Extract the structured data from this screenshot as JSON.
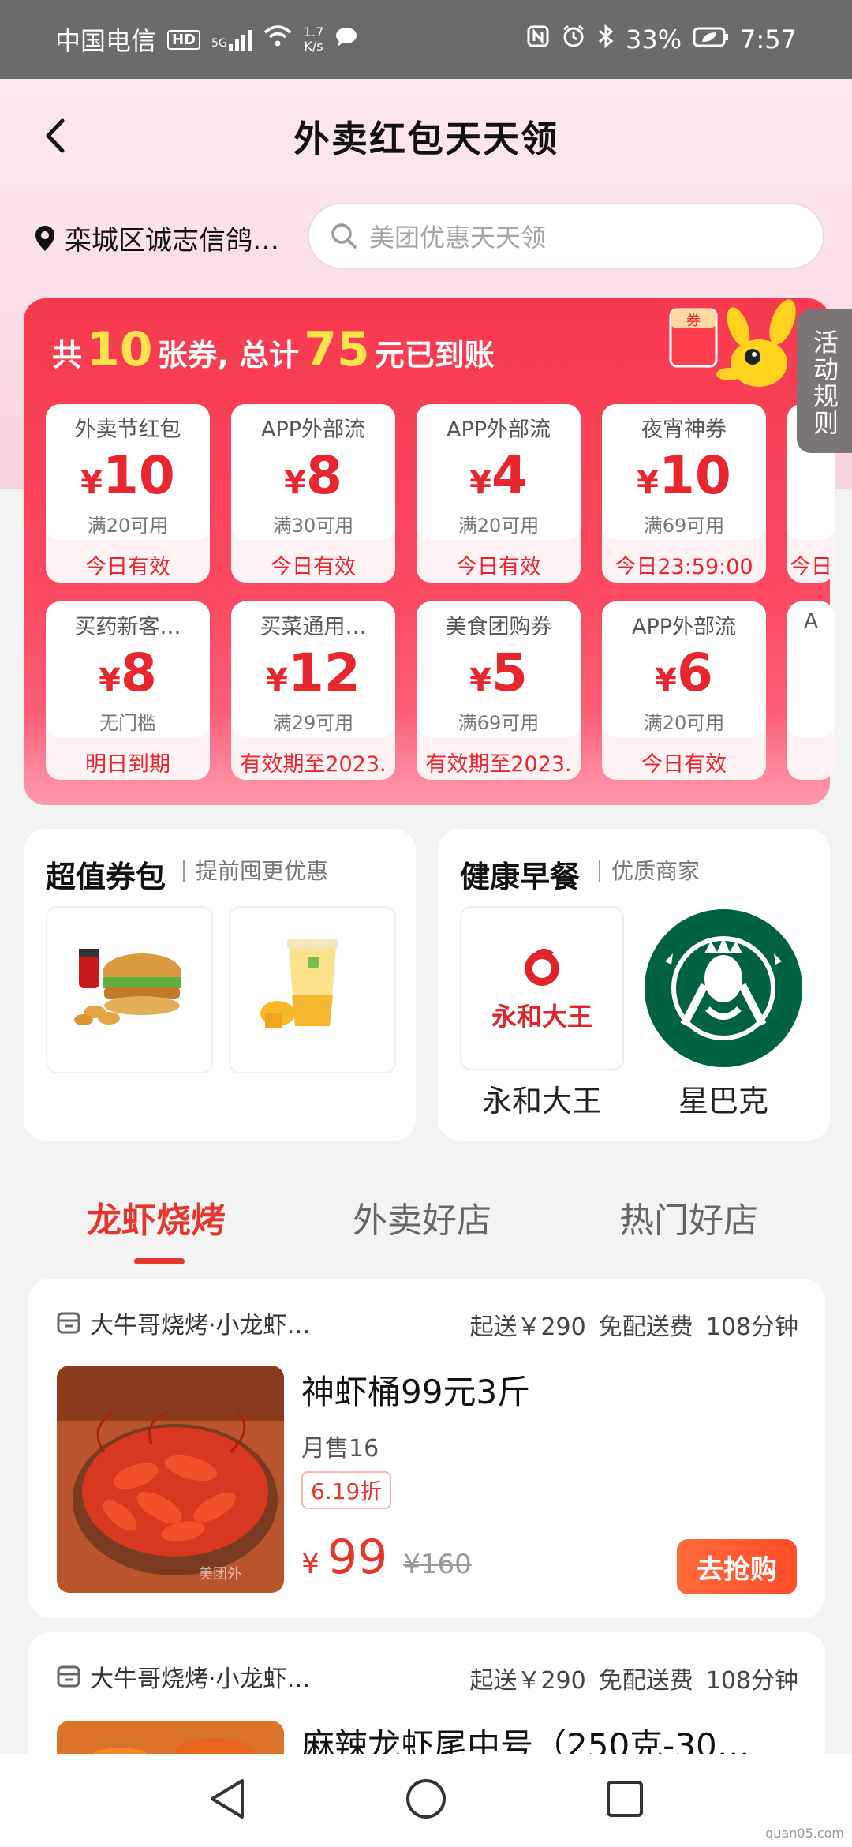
{
  "status_bar": {
    "carrier": "中国电信",
    "hd": "HD",
    "network": "5G",
    "speed_value": "1.7",
    "speed_unit": "K/s",
    "battery": "33%",
    "time": "7:57"
  },
  "header": {
    "title": "外卖红包天天领"
  },
  "location": {
    "text": "栾城区诚志信鸽…"
  },
  "search": {
    "placeholder": "美团优惠天天领"
  },
  "rules_tab": "活动规则",
  "summary": {
    "prefix": "共",
    "count": "10",
    "mid": "张券, 总计",
    "amount": "75",
    "suffix": "元已到账"
  },
  "coupons": [
    {
      "name": "外卖节红包",
      "symbol": "¥",
      "amount": "10",
      "condition": "满20可用",
      "validity": "今日有效"
    },
    {
      "name": "APP外部流",
      "symbol": "¥",
      "amount": "8",
      "condition": "满30可用",
      "validity": "今日有效"
    },
    {
      "name": "APP外部流",
      "symbol": "¥",
      "amount": "4",
      "condition": "满20可用",
      "validity": "今日有效"
    },
    {
      "name": "夜宵神券",
      "symbol": "¥",
      "amount": "10",
      "condition": "满69可用",
      "validity": "今日23:59:00"
    },
    {
      "name": "",
      "symbol": "",
      "amount": "",
      "condition": "",
      "validity": "今日"
    },
    {
      "name": "买药新客…",
      "symbol": "¥",
      "amount": "8",
      "condition": "无门槛",
      "validity": "明日到期"
    },
    {
      "name": "买菜通用…",
      "symbol": "¥",
      "amount": "12",
      "condition": "满29可用",
      "validity": "有效期至2023."
    },
    {
      "name": "美食团购券",
      "symbol": "¥",
      "amount": "5",
      "condition": "满69可用",
      "validity": "有效期至2023."
    },
    {
      "name": "APP外部流",
      "symbol": "¥",
      "amount": "6",
      "condition": "满20可用",
      "validity": "今日有效"
    },
    {
      "name": "A",
      "symbol": "",
      "amount": "",
      "condition": "",
      "validity": ""
    }
  ],
  "coupon_pack": {
    "title": "超值券包",
    "subtitle": "提前囤更优惠"
  },
  "breakfast": {
    "title": "健康早餐",
    "subtitle": "优质商家",
    "brands": [
      {
        "name": "永和大王",
        "logo_text": "永和大王"
      },
      {
        "name": "星巴克"
      }
    ]
  },
  "tabs": [
    "龙虾烧烤",
    "外卖好店",
    "热门好店"
  ],
  "shops": [
    {
      "name": "大牛哥烧烤·小龙虾…",
      "min_order": "起送￥290",
      "delivery": "免配送费",
      "time": "108分钟",
      "dish": "神虾桶99元3斤",
      "monthly_sales": "月售16",
      "discount": "6.19折",
      "price_symbol": "¥",
      "price": "99",
      "original_price": "¥160",
      "buy_label": "去抢购",
      "img_watermark": "美团外"
    },
    {
      "name": "大牛哥烧烤·小龙虾…",
      "min_order": "起送￥290",
      "delivery": "免配送费",
      "time": "108分钟",
      "dish": "麻辣龙虾尾中号（250克-30…"
    }
  ],
  "watermark": "quan05.com"
}
